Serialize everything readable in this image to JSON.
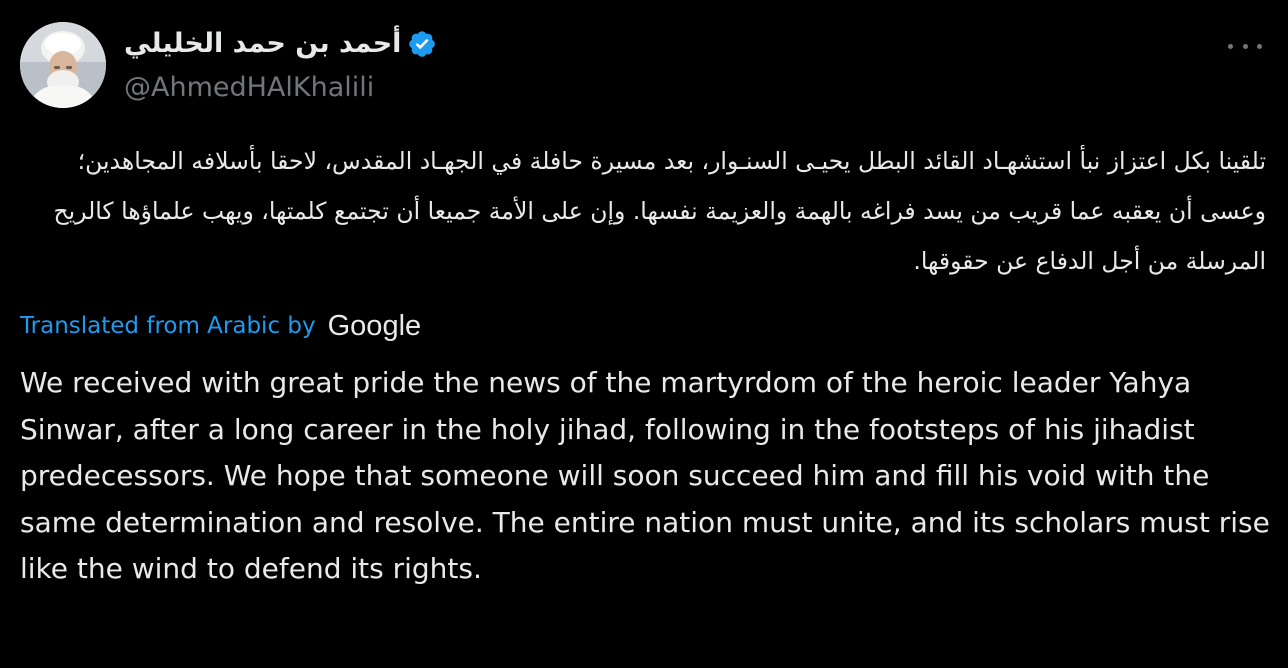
{
  "author": {
    "display_name": "أحمد بن حمد الخليلي",
    "handle": "@AhmedHAlKhalili",
    "verified": true,
    "avatar_icon": "profile-photo-avatar"
  },
  "menu": {
    "more_icon": "more-horizontal-icon"
  },
  "tweet": {
    "original_text": "تلقينا بكل اعتزاز نبأ استشهـاد القائد البطل يحيـى السنـوار، بعد مسيرة حافلة في الجهـاد المقدس، لاحقا بأسلافه المجاهدين؛ وعسى أن يعقبه عما قريب من يسد فراغه بالهمة والعزيمة نفسها. وإن على الأمة جميعا أن تجتمع كلمتها، ويهب علماؤها كالريح المرسلة من أجل الدفاع عن حقوقها.",
    "translated_label": "Translated from Arabic by",
    "translator_brand": "Google",
    "translation_text": "We received with great pride the news of the martyrdom of the heroic leader Yahya Sinwar, after a long career in the holy jihad, following in the footsteps of his jihadist predecessors. We hope that someone will soon succeed him and fill his void with the same determination and resolve. The entire nation must unite, and its scholars must rise like the wind to defend its rights."
  },
  "colors": {
    "background": "#000000",
    "text_primary": "#e7e9ea",
    "text_secondary": "#71767b",
    "link_blue": "#1d9bf0",
    "verified_blue": "#1d9bf0"
  }
}
